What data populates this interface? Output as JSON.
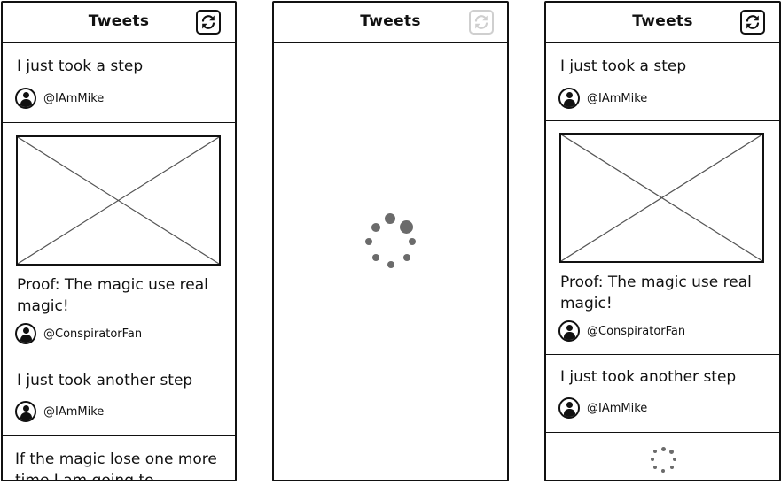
{
  "panels": [
    {
      "title": "Tweets",
      "refresh_icon": "refresh-icon",
      "refresh_enabled": true,
      "tweets": [
        {
          "text": "I just took a step",
          "author": "@IAmMike"
        },
        {
          "text": "Proof: The magic use real magic!",
          "author": "@ConspiratorFan",
          "has_image": true
        },
        {
          "text": "I just took another step",
          "author": "@IAmMike"
        },
        {
          "text": "If the magic lose one more time I am going to"
        }
      ]
    },
    {
      "title": "Tweets",
      "refresh_icon": "refresh-icon",
      "refresh_enabled": false,
      "loading_icon": "loading-spinner-icon"
    },
    {
      "title": "Tweets",
      "refresh_icon": "refresh-icon",
      "refresh_enabled": true,
      "tweets": [
        {
          "text": "I just took a step",
          "author": "@IAmMike"
        },
        {
          "text": "Proof: The magic use real magic!",
          "author": "@ConspiratorFan",
          "has_image": true
        },
        {
          "text": "I just took another step",
          "author": "@IAmMike"
        }
      ],
      "loading_icon": "loading-spinner-icon"
    }
  ]
}
